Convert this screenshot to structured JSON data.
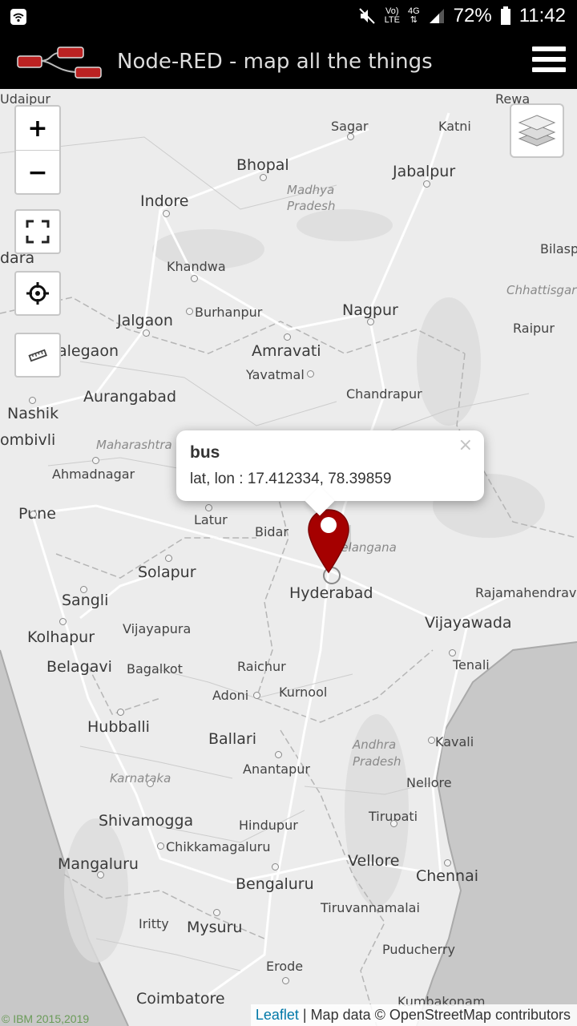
{
  "status_bar": {
    "battery": "72%",
    "time": "11:42",
    "network_4g": "4G",
    "volte_top": "Vo)",
    "volte_bottom": "LTE",
    "icons": [
      "wifi-icon",
      "mute-icon",
      "volte-icon",
      "signal-icon",
      "battery-icon"
    ]
  },
  "app_bar": {
    "title": "Node-RED - map all the things",
    "logo": "node-red-logo",
    "menu_icon": "hamburger-menu-icon"
  },
  "map_controls": {
    "zoom_in": "+",
    "zoom_out": "−",
    "icons": [
      "fullscreen-icon",
      "locate-icon",
      "ruler-icon",
      "layers-icon"
    ]
  },
  "popup": {
    "title": "bus",
    "body": "lat, lon : 17.412334, 78.39859",
    "close": "×"
  },
  "marker": {
    "color": "#a50000",
    "icon": "map-marker-icon"
  },
  "places": [
    "Udaipur",
    "Rewa",
    "Sagar",
    "Katni",
    "Bhopal",
    "Jabalpur",
    "Madhya",
    "Pradesh",
    "Indore",
    "dara",
    "Bilasp",
    "Khandwa",
    "Chhattisgar",
    "Burhanpur",
    "Nagpur",
    "Jalgaon",
    "Raipur",
    "alegaon",
    "Amravati",
    "Yavatmal",
    "Aurangabad",
    "Chandrapur",
    "Nashik",
    "ombivli",
    "Maharashtra",
    "Ahmadnagar",
    "Pune",
    "Latur",
    "Bidar",
    "Telangana",
    "Solapur",
    "Hyderabad",
    "Rajamahendrav",
    "Sangli",
    "Vijayawada",
    "Vijayapura",
    "Kolhapur",
    "Tenali",
    "Belagavi",
    "Bagalkot",
    "Raichur",
    "Adoni",
    "Kurnool",
    "Hubballi",
    "Ballari",
    "Andhra",
    "Pradesh",
    "Kavali",
    "Anantapur",
    "Karnataka",
    "Nellore",
    "Shivamogga",
    "Tirupati",
    "Hindupur",
    "Chikkamagaluru",
    "Mangaluru",
    "Vellore",
    "Chennai",
    "Bengaluru",
    "Tiruvannamalai",
    "Iritty",
    "Mysuru",
    "Puducherry",
    "Erode",
    "Coimbatore",
    "Kumbakonam"
  ],
  "attribution": {
    "leaflet": "Leaflet",
    "separator": " | ",
    "map_data": "Map data © OpenStreetMap contributors"
  },
  "copyright": "© IBM 2015,2019"
}
